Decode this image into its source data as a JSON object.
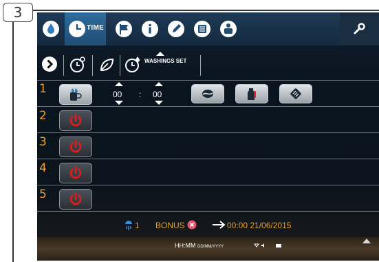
{
  "step_number": "3",
  "topbar": {
    "active_tab_label": "TIME",
    "icons": [
      "water-drop-icon",
      "clock-icon",
      "flag-icon",
      "info-icon",
      "pencil-icon",
      "list-icon",
      "people-icon",
      "wrench-icon"
    ]
  },
  "subbar": {
    "washings_label": "WASHINGS SET"
  },
  "rows": [
    {
      "number": "1",
      "hours": "00",
      "separator": ":",
      "minutes": "00"
    },
    {
      "number": "2"
    },
    {
      "number": "3"
    },
    {
      "number": "4"
    },
    {
      "number": "5"
    }
  ],
  "footer": {
    "wash_count": "1",
    "bonus_label": "BONUS",
    "schedule_time": "00:00 21/06/2015",
    "clock_format": "HH:MM",
    "date_format": "DD/MM/YYYY"
  },
  "colors": {
    "accent_orange": "#f0a020",
    "power_red": "#e21b1b",
    "active_tab": "#2f6c9e"
  }
}
